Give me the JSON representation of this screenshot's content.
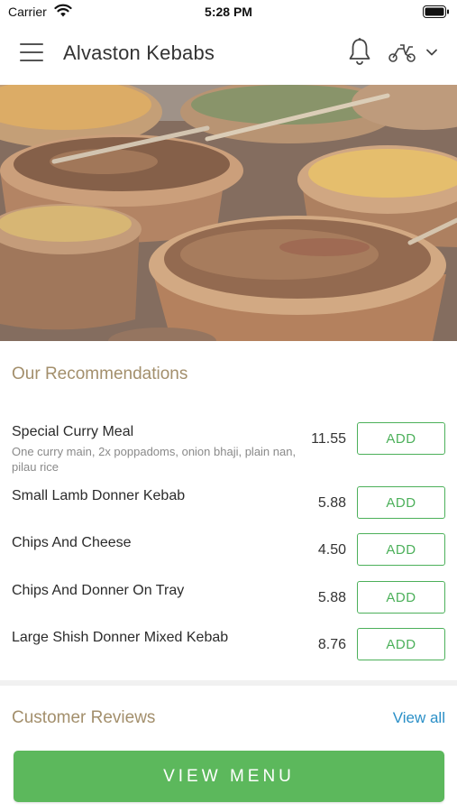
{
  "status_bar": {
    "carrier": "Carrier",
    "time": "5:28 PM"
  },
  "header": {
    "title": "Alvaston Kebabs",
    "icons": [
      "hamburger-icon",
      "bell-icon",
      "scooter-icon",
      "chevron-down-icon"
    ]
  },
  "recommendations": {
    "title": "Our Recommendations",
    "add_label": "ADD",
    "items": [
      {
        "name": "Special Curry Meal",
        "description": "One curry main, 2x poppadoms, onion bhaji, plain nan, pilau rice",
        "price": "11.55"
      },
      {
        "name": "Small Lamb Donner Kebab",
        "description": "",
        "price": "5.88"
      },
      {
        "name": "Chips And Cheese",
        "description": "",
        "price": "4.50"
      },
      {
        "name": "Chips And Donner On Tray",
        "description": "",
        "price": "5.88"
      },
      {
        "name": "Large Shish Donner Mixed Kebab",
        "description": "",
        "price": "8.76"
      }
    ]
  },
  "reviews": {
    "title": "Customer Reviews",
    "view_all": "View all"
  },
  "footer": {
    "view_menu_label": "VIEW MENU"
  },
  "colors": {
    "accent_green": "#5cb85c",
    "section_title": "#a38f6c",
    "link_blue": "#2a8fc7"
  }
}
